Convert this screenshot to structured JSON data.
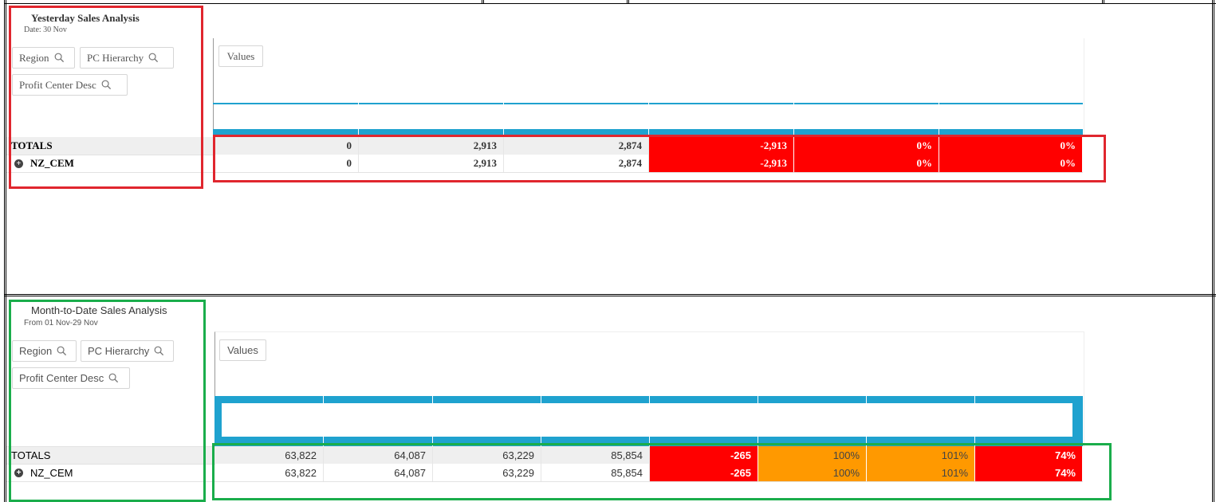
{
  "yesterday": {
    "title": "Yesterday Sales Analysis",
    "subtitle": "Date: 30 Nov",
    "filters": {
      "region": "Region",
      "pc_hierarchy": "PC Hierarchy",
      "profit_center_desc": "Profit Center Desc"
    },
    "values_label": "Values",
    "rows": [
      {
        "label": "TOTALS",
        "cells": [
          "0",
          "2,913",
          "2,874",
          "-2,913",
          "0%",
          "0%"
        ]
      },
      {
        "label": "NZ_CEM",
        "cells": [
          "0",
          "2,913",
          "2,874",
          "-2,913",
          "0%",
          "0%"
        ]
      }
    ],
    "cell_colors": [
      "none",
      "none",
      "none",
      "red",
      "red",
      "red"
    ]
  },
  "month_to_date": {
    "title": "Month-to-Date Sales Analysis",
    "subtitle": "From 01 Nov-29 Nov",
    "filters": {
      "region": "Region",
      "pc_hierarchy": "PC Hierarchy",
      "profit_center_desc": "Profit Center Desc"
    },
    "values_label": "Values",
    "rows": [
      {
        "label": "TOTALS",
        "cells": [
          "63,822",
          "64,087",
          "63,229",
          "85,854",
          "-265",
          "100%",
          "101%",
          "74%"
        ]
      },
      {
        "label": "NZ_CEM",
        "cells": [
          "63,822",
          "64,087",
          "63,229",
          "85,854",
          "-265",
          "100%",
          "101%",
          "74%"
        ]
      }
    ],
    "cell_colors": [
      "none",
      "none",
      "none",
      "none",
      "red",
      "orange",
      "orange",
      "red"
    ]
  },
  "colors": {
    "header_blue": "#1fa2cf",
    "negative_red": "#ff0000",
    "warning_orange": "#ff9900",
    "annotation_red": "#e0262e",
    "annotation_green": "#1aad4b"
  },
  "icons": {
    "filter_search": "search-icon",
    "expand_row": "plus-circle-icon"
  }
}
